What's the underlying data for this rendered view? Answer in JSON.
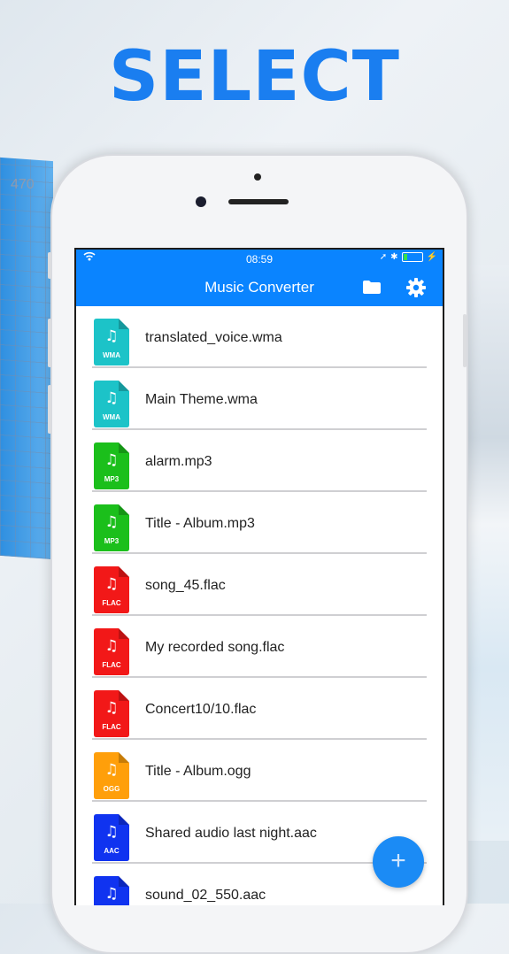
{
  "headline": "SELECT",
  "background": {
    "chart_label": "470"
  },
  "status_bar": {
    "time": "08:59",
    "wifi_icon": "wifi-icon",
    "location_icon": "location-arrow-icon",
    "bluetooth_icon": "bluetooth-icon",
    "battery_icon": "battery-icon",
    "charging_icon": "bolt-icon"
  },
  "nav": {
    "title": "Music Converter",
    "folder_icon": "folder-icon",
    "settings_icon": "gear-icon"
  },
  "colors": {
    "accent": "#0a84ff",
    "wma": "#1cc3c8",
    "mp3": "#1bbf1b",
    "flac": "#f21818",
    "ogg": "#ff9f0a",
    "aac": "#1033f0"
  },
  "files": [
    {
      "name": "translated_voice.wma",
      "type": "WMA"
    },
    {
      "name": "Main Theme.wma",
      "type": "WMA"
    },
    {
      "name": "alarm.mp3",
      "type": "MP3"
    },
    {
      "name": "Title  - Album.mp3",
      "type": "MP3"
    },
    {
      "name": "song_45.flac",
      "type": "FLAC"
    },
    {
      "name": "My recorded song.flac",
      "type": "FLAC"
    },
    {
      "name": "Concert10/10.flac",
      "type": "FLAC"
    },
    {
      "name": "Title - Album.ogg",
      "type": "OGG"
    },
    {
      "name": "Shared audio last night.aac",
      "type": "AAC"
    },
    {
      "name": "sound_02_550.aac",
      "type": "AAC"
    }
  ],
  "fab": {
    "label": "+",
    "icon": "plus-icon"
  }
}
